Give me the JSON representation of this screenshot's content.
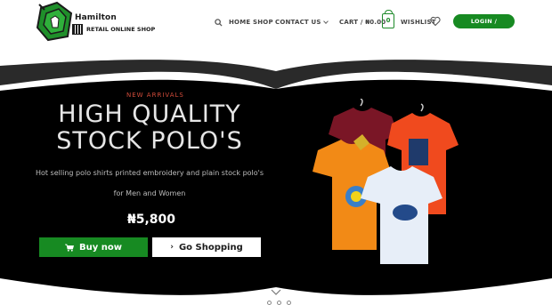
{
  "brand": {
    "name": "Hamilton",
    "tagline": "RETAIL ONLINE SHOP",
    "logo_icon": "t-shirt-hanger-logo"
  },
  "nav": {
    "search_icon": "search-icon",
    "home": "HOME",
    "shop": "SHOP",
    "contact": "CONTACT US",
    "cart": "CART / ₦0.00",
    "cart_count": "0",
    "wishlist": "WISHLIST",
    "login": "LOGIN / REGISTER"
  },
  "hero": {
    "kicker": "NEW ARRIVALS",
    "headline_line1": "HIGH QUALITY",
    "headline_line2": "STOCK POLO'S",
    "description_line1": "Hot selling polo shirts printed embroidery and plain stock polo's",
    "description_line2": "for Men and Women",
    "price": "₦5,800",
    "buy_label": "Buy now",
    "shop_label": "Go Shopping",
    "slide_count": 4,
    "active_slide": 1
  },
  "colors": {
    "brand_green": "#178a22",
    "hero_bg": "#000000",
    "kicker_red": "#d24b3a"
  }
}
